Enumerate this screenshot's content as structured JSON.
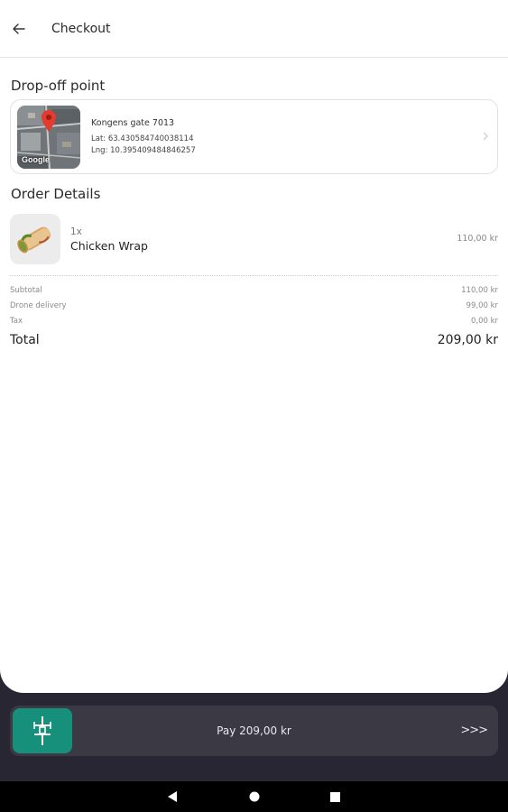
{
  "header": {
    "title": "Checkout"
  },
  "dropoff": {
    "section_title": "Drop-off point",
    "address": "Kongens gate 7013",
    "lat": "Lat: 63.4305847400381​14",
    "lng": "Lng: 10.395409484846257",
    "map_watermark": "Google"
  },
  "order": {
    "section_title": "Order Details",
    "items": [
      {
        "qty": "1x",
        "name": "Chicken Wrap",
        "price": "110,00 kr"
      }
    ]
  },
  "summary": {
    "rows": [
      {
        "label": "Subtotal",
        "value": "110,00 kr"
      },
      {
        "label": "Drone delivery",
        "value": "99,00 kr"
      },
      {
        "label": "Tax",
        "value": "0,00 kr"
      }
    ],
    "total_label": "Total",
    "total_value": "209,00 kr"
  },
  "pay": {
    "label": "Pay 209,00 kr",
    "arrows": ">>>"
  },
  "colors": {
    "accent": "#16907a",
    "dark_bg": "#272632",
    "pay_bar": "#3a3944"
  },
  "icons": [
    "arrow-left-icon",
    "chevron-right-icon",
    "map-pin-icon",
    "drone-icon",
    "nav-back-icon",
    "nav-home-icon",
    "nav-recents-icon"
  ]
}
